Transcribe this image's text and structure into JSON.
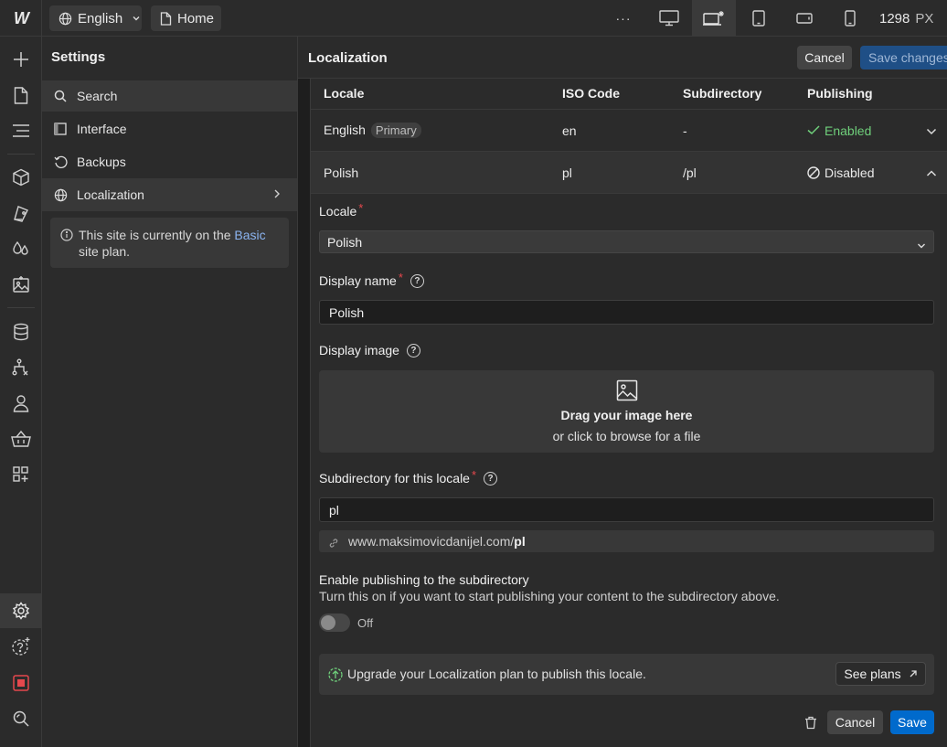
{
  "topbar": {
    "logo": "W",
    "locale_label": "English",
    "page_label": "Home",
    "more": "···",
    "width_value": "1298",
    "width_unit": "PX"
  },
  "settings": {
    "title": "Settings",
    "nav": [
      {
        "label": "Search",
        "icon": "search-icon"
      },
      {
        "label": "Interface",
        "icon": "sidebar-icon"
      },
      {
        "label": "Backups",
        "icon": "history-icon"
      },
      {
        "label": "Localization",
        "icon": "globe-icon"
      }
    ],
    "notice_text": "This site is currently on the ",
    "notice_link": "Basic",
    "notice_text2": "site plan."
  },
  "main": {
    "title": "Localization",
    "cancel_label": "Cancel",
    "save_changes_label": "Save changes",
    "columns": [
      "Locale",
      "ISO Code",
      "Subdirectory",
      "Publishing"
    ],
    "rows": [
      {
        "locale": "English",
        "badge": "Primary",
        "iso": "en",
        "subdir": "-",
        "publishing": "Enabled"
      },
      {
        "locale": "Polish",
        "iso": "pl",
        "subdir": "/pl",
        "publishing": "Disabled"
      }
    ],
    "form": {
      "locale_label": "Locale",
      "locale_value": "Polish",
      "display_name_label": "Display name",
      "display_name_value": "Polish",
      "display_image_label": "Display image",
      "drop_title": "Drag your image here",
      "drop_sub": "or click to browse for a file",
      "subdir_label": "Subdirectory for this locale",
      "subdir_value": "pl",
      "url_prefix": "www.maksimovicdanijel.com/",
      "url_suffix": "pl",
      "publish_title": "Enable publishing to the subdirectory",
      "publish_desc": "Turn this on if you want to start publishing your content to the subdirectory above.",
      "toggle_state": "Off",
      "upgrade_text": "Upgrade your Localization plan to publish this locale.",
      "see_plans_label": "See plans",
      "cancel_label": "Cancel",
      "save_label": "Save"
    }
  },
  "colors": {
    "accent": "#006acc",
    "enabled": "#6fcf7b",
    "required": "#e5484d"
  }
}
